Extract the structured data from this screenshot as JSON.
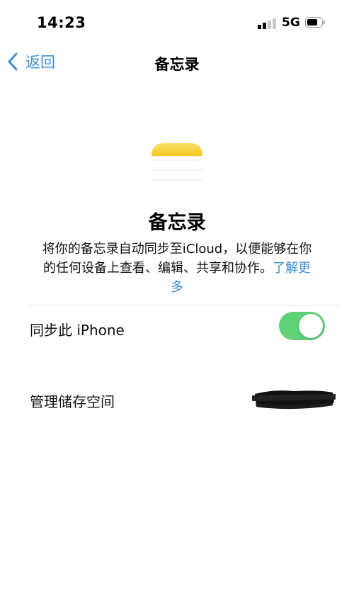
{
  "status_bar": {
    "time": "14:23",
    "network": "5G",
    "signal_bars_active": 2,
    "signal_bars_total": 4,
    "battery_level": 0.6
  },
  "nav": {
    "back_label": "返回",
    "title": "备忘录"
  },
  "header": {
    "app_icon": "notes-app-icon",
    "title": "备忘录",
    "description": "将你的备忘录自动同步至iCloud，以便能够在你的任何设备上查看、编辑、共享和协作。",
    "learn_more": "了解更多"
  },
  "settings": {
    "sync_label": "同步此 iPhone",
    "sync_enabled": true,
    "manage_storage_label": "管理储存空间"
  },
  "colors": {
    "accent": "#3a8fd6",
    "toggle_on": "#5fd278",
    "notes_yellow": "#f6cd2f"
  }
}
